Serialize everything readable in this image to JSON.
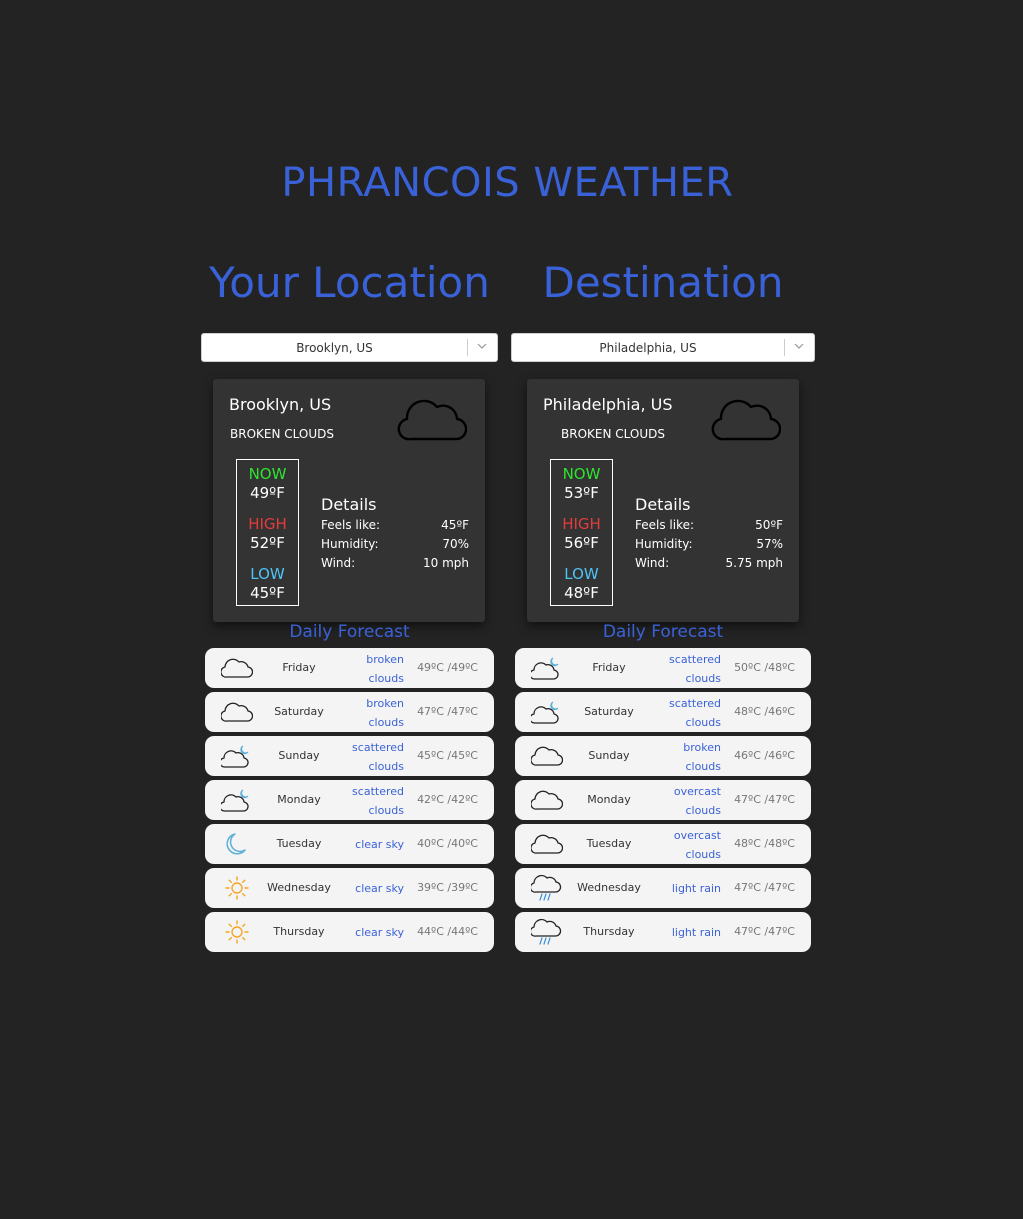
{
  "app": {
    "title": "PHRANCOIS WEATHER"
  },
  "colors": {
    "background": "#232323",
    "card": "#333333",
    "accent": "#3a62d8",
    "now": "#2fe32f",
    "high": "#e23c3c",
    "low": "#4ec3f5",
    "sun": "#f5a623",
    "moon": "#5bb0d6",
    "row": "#f4f4f4"
  },
  "left": {
    "heading": "Your Location",
    "select_value": "Brooklyn, US",
    "card": {
      "city": "Brooklyn, US",
      "description": "BROKEN CLOUDS",
      "icon": "cloud-icon",
      "now_label": "NOW",
      "now_value": "49ºF",
      "high_label": "HIGH",
      "high_value": "52ºF",
      "low_label": "LOW",
      "low_value": "45ºF",
      "details_title": "Details",
      "feels_label": "Feels like:",
      "feels_value": "45ºF",
      "humidity_label": "Humidity:",
      "humidity_value": "70%",
      "wind_label": "Wind:",
      "wind_value": "10 mph"
    },
    "forecast_heading": "Daily Forecast",
    "forecast": [
      {
        "day": "Friday",
        "desc1": "broken",
        "desc2": "clouds",
        "temp": "49ºC /49ºC",
        "icon": "cloud-icon"
      },
      {
        "day": "Saturday",
        "desc1": "broken",
        "desc2": "clouds",
        "temp": "47ºC /47ºC",
        "icon": "cloud-icon"
      },
      {
        "day": "Sunday",
        "desc1": "scattered",
        "desc2": "clouds",
        "temp": "45ºC /45ºC",
        "icon": "cloud-moon-icon"
      },
      {
        "day": "Monday",
        "desc1": "scattered",
        "desc2": "clouds",
        "temp": "42ºC /42ºC",
        "icon": "cloud-moon-icon"
      },
      {
        "day": "Tuesday",
        "desc1": "clear sky",
        "desc2": "",
        "temp": "40ºC /40ºC",
        "icon": "moon-icon"
      },
      {
        "day": "Wednesday",
        "desc1": "clear sky",
        "desc2": "",
        "temp": "39ºC /39ºC",
        "icon": "sun-icon"
      },
      {
        "day": "Thursday",
        "desc1": "clear sky",
        "desc2": "",
        "temp": "44ºC /44ºC",
        "icon": "sun-icon"
      }
    ]
  },
  "right": {
    "heading": "Destination",
    "select_value": "Philadelphia, US",
    "card": {
      "city": "Philadelphia, US",
      "description": "BROKEN CLOUDS",
      "icon": "cloud-icon",
      "now_label": "NOW",
      "now_value": "53ºF",
      "high_label": "HIGH",
      "high_value": "56ºF",
      "low_label": "LOW",
      "low_value": "48ºF",
      "details_title": "Details",
      "feels_label": "Feels like:",
      "feels_value": "50ºF",
      "humidity_label": "Humidity:",
      "humidity_value": "57%",
      "wind_label": "Wind:",
      "wind_value": "5.75 mph"
    },
    "forecast_heading": "Daily Forecast",
    "forecast": [
      {
        "day": "Friday",
        "desc1": "scattered",
        "desc2": "clouds",
        "temp": "50ºC /48ºC",
        "icon": "cloud-moon-icon"
      },
      {
        "day": "Saturday",
        "desc1": "scattered",
        "desc2": "clouds",
        "temp": "48ºC /46ºC",
        "icon": "cloud-moon-icon"
      },
      {
        "day": "Sunday",
        "desc1": "broken",
        "desc2": "clouds",
        "temp": "46ºC /46ºC",
        "icon": "cloud-icon"
      },
      {
        "day": "Monday",
        "desc1": "overcast",
        "desc2": "clouds",
        "temp": "47ºC /47ºC",
        "icon": "cloud-icon"
      },
      {
        "day": "Tuesday",
        "desc1": "overcast",
        "desc2": "clouds",
        "temp": "48ºC /48ºC",
        "icon": "cloud-icon"
      },
      {
        "day": "Wednesday",
        "desc1": "light rain",
        "desc2": "",
        "temp": "47ºC /47ºC",
        "icon": "rain-icon"
      },
      {
        "day": "Thursday",
        "desc1": "light rain",
        "desc2": "",
        "temp": "47ºC /47ºC",
        "icon": "rain-icon"
      }
    ]
  }
}
